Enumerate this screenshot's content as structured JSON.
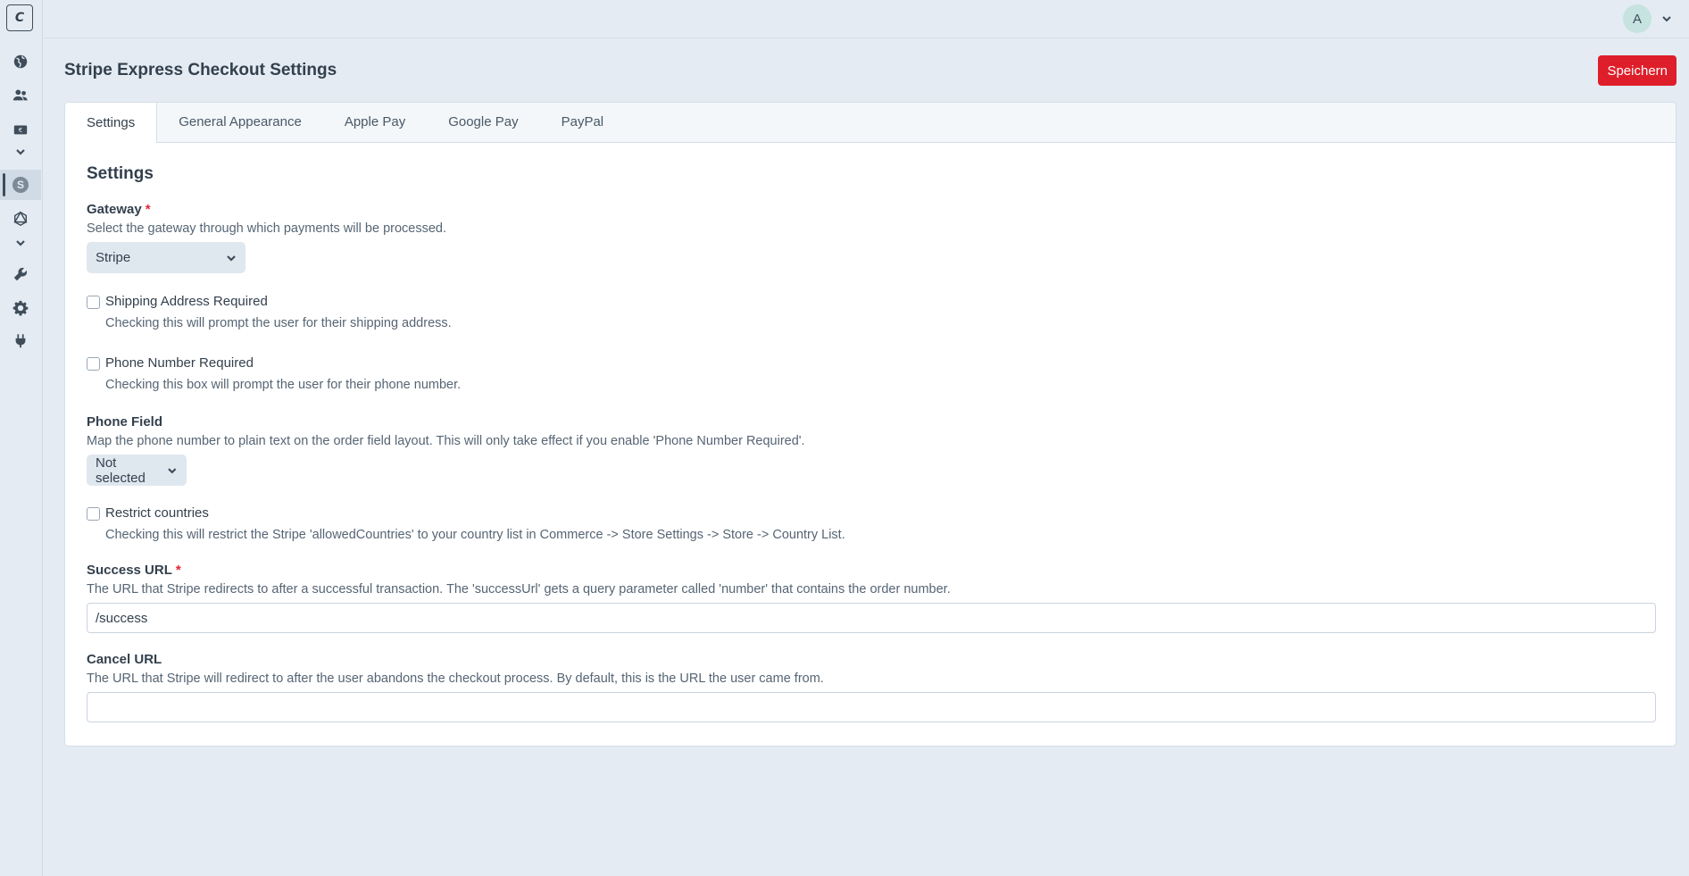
{
  "app": {
    "logo_letter": "C"
  },
  "sidebar": {
    "items": [
      {
        "icon": "globe-icon"
      },
      {
        "icon": "users-icon"
      },
      {
        "icon": "currency-icon"
      },
      {
        "icon": "chevron-down-icon"
      },
      {
        "icon": "stripe-icon",
        "glyph": "S",
        "active": true
      },
      {
        "icon": "graphql-icon"
      },
      {
        "icon": "chevron-down-icon"
      },
      {
        "icon": "wrench-icon"
      },
      {
        "icon": "gear-icon"
      },
      {
        "icon": "plug-icon"
      }
    ]
  },
  "header": {
    "avatar_letter": "A"
  },
  "page": {
    "title": "Stripe Express Checkout Settings",
    "save_label": "Speichern"
  },
  "tabs": [
    {
      "label": "Settings",
      "active": true
    },
    {
      "label": "General Appearance"
    },
    {
      "label": "Apple Pay"
    },
    {
      "label": "Google Pay"
    },
    {
      "label": "PayPal"
    }
  ],
  "form": {
    "section_title": "Settings",
    "gateway": {
      "label": "Gateway",
      "required_mark": "*",
      "help": "Select the gateway through which payments will be processed.",
      "value": "Stripe"
    },
    "shipping": {
      "label": "Shipping Address Required",
      "help": "Checking this will prompt the user for their shipping address.",
      "checked": false
    },
    "phone_required": {
      "label": "Phone Number Required",
      "help": "Checking this box will prompt the user for their phone number.",
      "checked": false
    },
    "phone_field": {
      "label": "Phone Field",
      "help": "Map the phone number to plain text on the order field layout. This will only take effect if you enable 'Phone Number Required'.",
      "value": "Not selected"
    },
    "restrict": {
      "label": "Restrict countries",
      "help": "Checking this will restrict the Stripe 'allowedCountries' to your country list in Commerce -> Store Settings -> Store -> Country List.",
      "checked": false
    },
    "success_url": {
      "label": "Success URL",
      "required_mark": "*",
      "help": "The URL that Stripe redirects to after a successful transaction. The 'successUrl' gets a query parameter called 'number' that contains the order number.",
      "value": "/success"
    },
    "cancel_url": {
      "label": "Cancel URL",
      "help": "The URL that Stripe will redirect to after the user abandons the checkout process. By default, this is the URL the user came from.",
      "value": ""
    }
  },
  "colors": {
    "accent": "#de1e2a",
    "background": "#e4ebf3",
    "required": "#e5243b"
  }
}
